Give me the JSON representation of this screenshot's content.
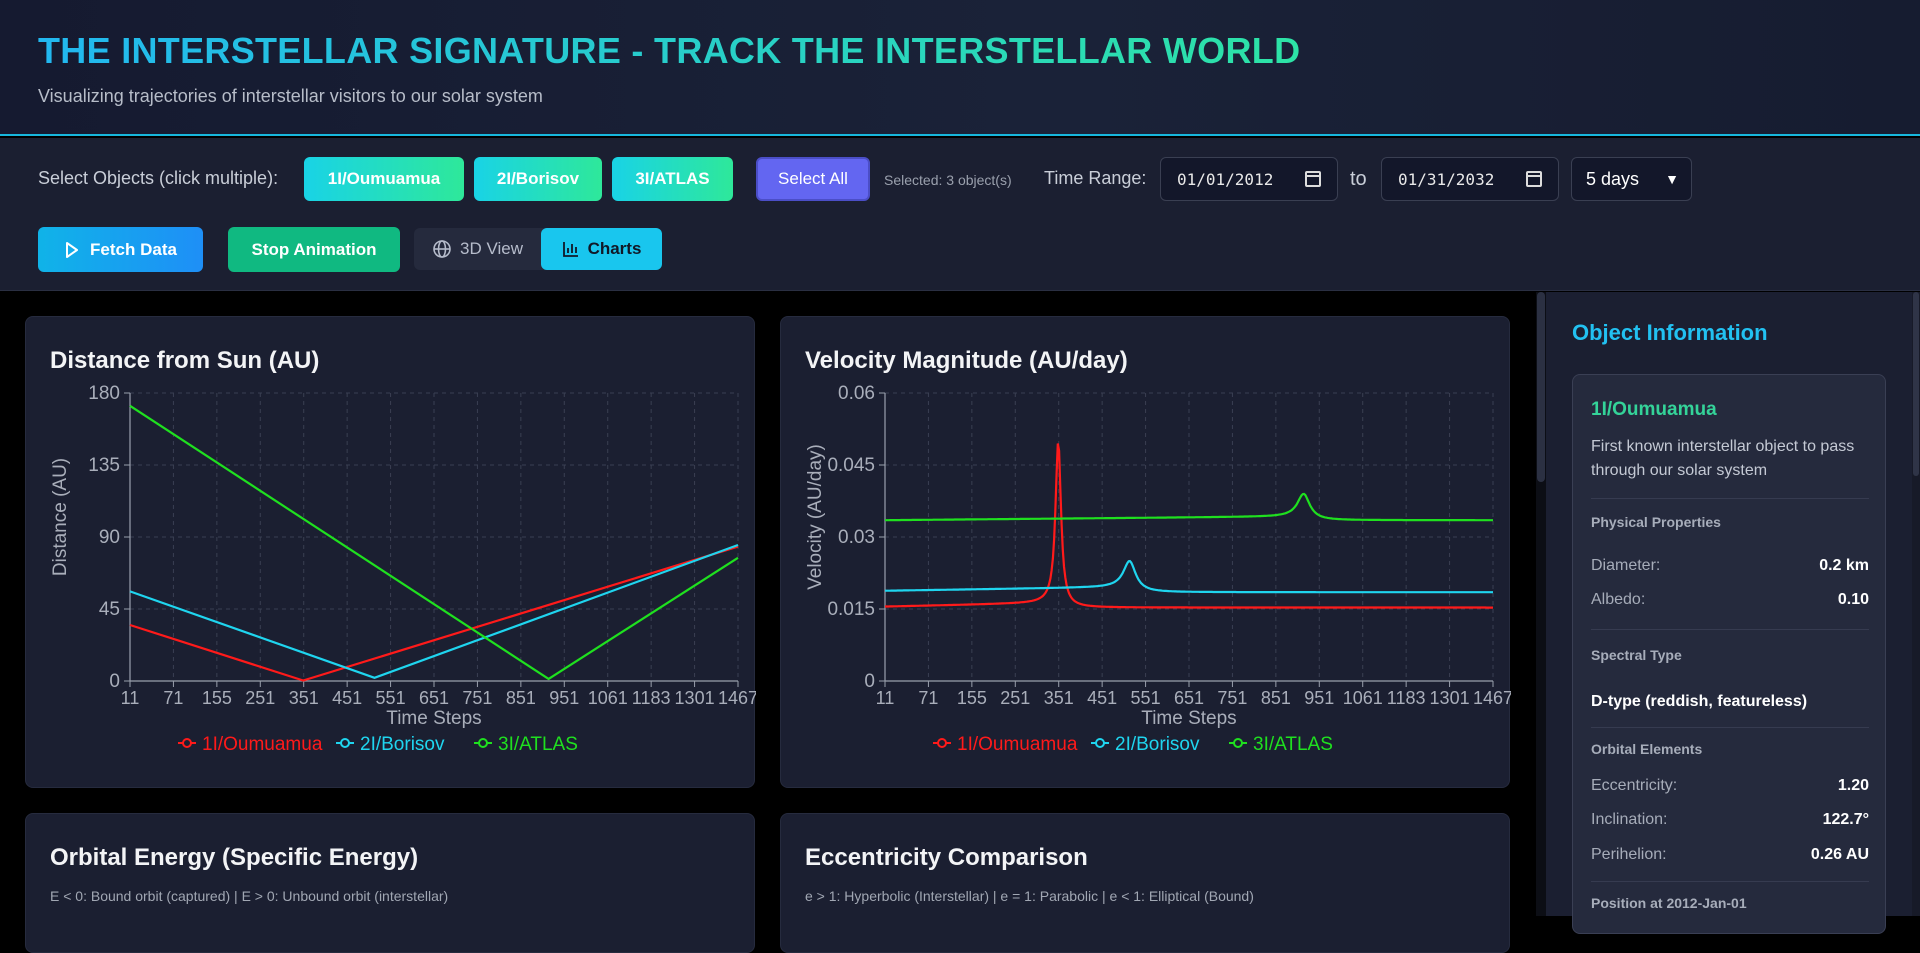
{
  "header": {
    "title": "THE INTERSTELLAR SIGNATURE - TRACK THE INTERSTELLAR WORLD",
    "subtitle": "Visualizing trajectories of interstellar visitors to our solar system"
  },
  "controls": {
    "select_label": "Select Objects (click multiple):",
    "objects": [
      "1I/Oumuamua",
      "2I/Borisov",
      "3I/ATLAS"
    ],
    "select_all": "Select All",
    "selected_count": "Selected: 3 object(s)",
    "time_range_label": "Time Range:",
    "start_date": "01/01/2012",
    "to_label": "to",
    "end_date": "01/31/2032",
    "step_value": "5 days",
    "fetch_label": "Fetch Data",
    "stop_label": "Stop Animation",
    "view_3d_label": "3D View",
    "charts_label": "Charts"
  },
  "colors": {
    "oumuamua": "#ff1a1a",
    "borisov": "#1fd5ef",
    "atlas": "#1fe01f",
    "accent": "#22c1f1"
  },
  "icons": {
    "fetch": "play-icon",
    "view3d": "globe-icon",
    "charts": "bar-chart-icon",
    "select": "chevron-down-icon",
    "date": "calendar-icon"
  },
  "cards": {
    "distance_title": "Distance from Sun (AU)",
    "velocity_title": "Velocity Magnitude (AU/day)",
    "energy_title": "Orbital Energy (Specific Energy)",
    "energy_note": "E < 0: Bound orbit (captured) | E > 0: Unbound orbit (interstellar)",
    "ecc_title": "Eccentricity Comparison",
    "ecc_note": "e > 1: Hyperbolic (Interstellar) | e = 1: Parabolic | e < 1: Elliptical (Bound)"
  },
  "chart_data": [
    {
      "type": "line",
      "title": "Distance from Sun (AU)",
      "xlabel": "Time Steps",
      "ylabel": "Distance (AU)",
      "x_ticks": [
        "11",
        "71",
        "155",
        "251",
        "351",
        "451",
        "551",
        "651",
        "751",
        "851",
        "951",
        "1061",
        "1183",
        "1301",
        "1467"
      ],
      "xlim": [
        0,
        1467
      ],
      "ylim": [
        0,
        180
      ],
      "y_ticks": [
        "0",
        "45",
        "90",
        "135",
        "180"
      ],
      "grid": true,
      "legend": "bottom",
      "series": [
        {
          "name": "1I/Oumuamua",
          "x": [
            0,
            418,
            1467
          ],
          "y": [
            35,
            0.3,
            84
          ]
        },
        {
          "name": "2I/Borisov",
          "x": [
            0,
            590,
            1467
          ],
          "y": [
            56,
            2,
            85
          ]
        },
        {
          "name": "3I/ATLAS",
          "x": [
            0,
            1010,
            1467
          ],
          "y": [
            172,
            1.3,
            77
          ]
        }
      ]
    },
    {
      "type": "line",
      "title": "Velocity Magnitude (AU/day)",
      "xlabel": "Time Steps",
      "ylabel": "Velocity (AU/day)",
      "x_ticks": [
        "11",
        "71",
        "155",
        "251",
        "351",
        "451",
        "551",
        "651",
        "751",
        "851",
        "951",
        "1061",
        "1183",
        "1301",
        "1467"
      ],
      "xlim": [
        0,
        1467
      ],
      "ylim": [
        0,
        0.06
      ],
      "y_ticks": [
        "0",
        "0.015",
        "0.03",
        "0.045",
        "0.06"
      ],
      "grid": true,
      "legend": "bottom",
      "series": [
        {
          "name": "1I/Oumuamua",
          "base": 0.0155,
          "peak": 0.05,
          "peak_x": 418,
          "tail": 0.0153
        },
        {
          "name": "2I/Borisov",
          "base": 0.0188,
          "peak": 0.025,
          "peak_x": 590,
          "tail": 0.0185
        },
        {
          "name": "3I/ATLAS",
          "base": 0.0335,
          "peak": 0.039,
          "peak_x": 1010,
          "tail": 0.0335
        }
      ]
    }
  ],
  "sidebar": {
    "title": "Object Information",
    "object_name": "1I/Oumuamua",
    "description": "First known interstellar object to pass through our solar system",
    "physical_label": "Physical Properties",
    "diameter_label": "Diameter:",
    "diameter_value": "0.2 km",
    "albedo_label": "Albedo:",
    "albedo_value": "0.10",
    "spectral_label": "Spectral Type",
    "spectral_value": "D-type (reddish, featureless)",
    "orbital_label": "Orbital Elements",
    "ecc_label": "Eccentricity:",
    "ecc_value": "1.20",
    "incl_label": "Inclination:",
    "incl_value": "122.7°",
    "peri_label": "Perihelion:",
    "peri_value": "0.26 AU",
    "position_label": "Position at 2012-Jan-01"
  }
}
